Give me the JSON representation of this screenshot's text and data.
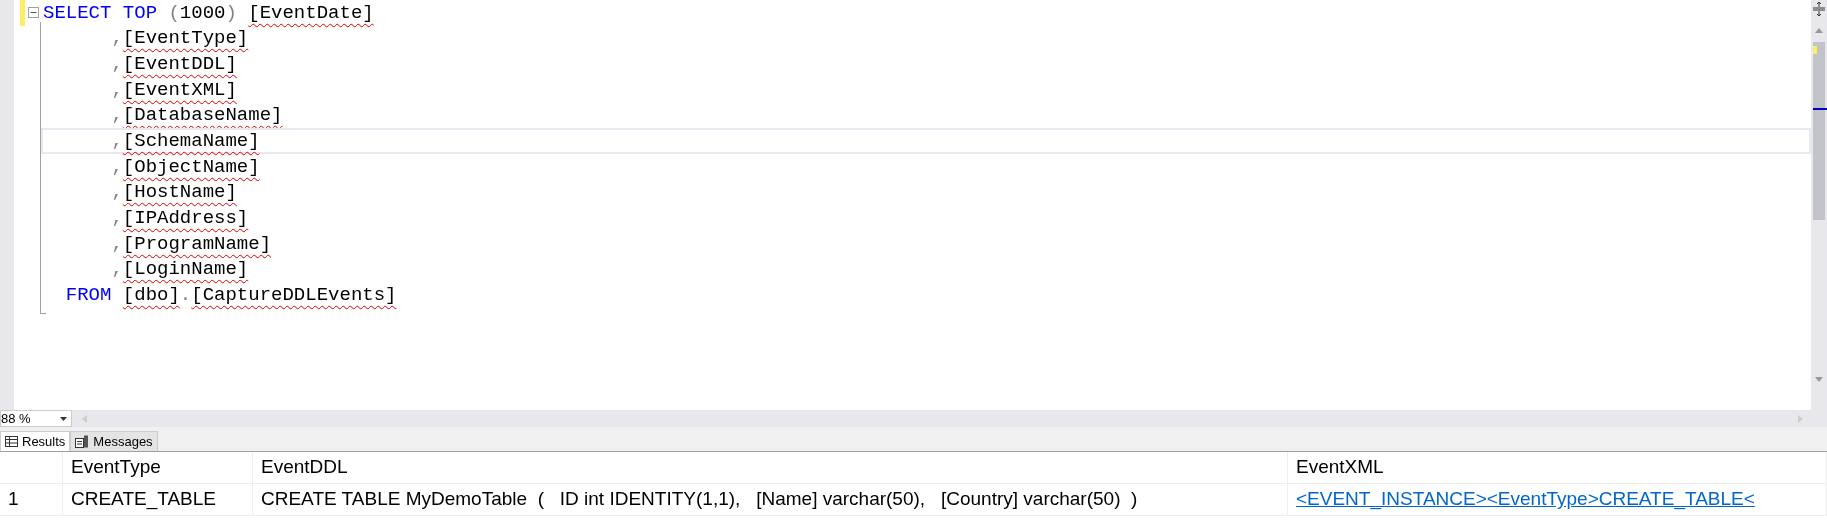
{
  "editor": {
    "lines": [
      {
        "changed": true,
        "current": false,
        "fold": true,
        "tokens": [
          {
            "text": "SELECT ",
            "kind": "keyword"
          },
          {
            "text": "TOP ",
            "kind": "keyword"
          },
          {
            "text": "(",
            "kind": "punct"
          },
          {
            "text": "1000",
            "kind": "number"
          },
          {
            "text": ") ",
            "kind": "punct"
          },
          {
            "text": "[EventDate]",
            "kind": "ident"
          }
        ]
      },
      {
        "changed": false,
        "current": false,
        "fold": false,
        "tokens": [
          {
            "text": "      ,",
            "kind": "punct"
          },
          {
            "text": "[EventType]",
            "kind": "ident"
          }
        ]
      },
      {
        "changed": false,
        "current": false,
        "fold": false,
        "tokens": [
          {
            "text": "      ,",
            "kind": "punct"
          },
          {
            "text": "[EventDDL]",
            "kind": "ident"
          }
        ]
      },
      {
        "changed": false,
        "current": false,
        "fold": false,
        "tokens": [
          {
            "text": "      ,",
            "kind": "punct"
          },
          {
            "text": "[EventXML]",
            "kind": "ident"
          }
        ]
      },
      {
        "changed": false,
        "current": false,
        "fold": false,
        "tokens": [
          {
            "text": "      ,",
            "kind": "punct"
          },
          {
            "text": "[DatabaseName]",
            "kind": "ident"
          }
        ]
      },
      {
        "changed": false,
        "current": true,
        "fold": false,
        "tokens": [
          {
            "text": "      ,",
            "kind": "punct"
          },
          {
            "text": "[SchemaName]",
            "kind": "ident"
          }
        ]
      },
      {
        "changed": false,
        "current": false,
        "fold": false,
        "tokens": [
          {
            "text": "      ,",
            "kind": "punct"
          },
          {
            "text": "[ObjectName]",
            "kind": "ident"
          }
        ]
      },
      {
        "changed": false,
        "current": false,
        "fold": false,
        "tokens": [
          {
            "text": "      ,",
            "kind": "punct"
          },
          {
            "text": "[HostName]",
            "kind": "ident"
          }
        ]
      },
      {
        "changed": false,
        "current": false,
        "fold": false,
        "tokens": [
          {
            "text": "      ,",
            "kind": "punct"
          },
          {
            "text": "[IPAddress]",
            "kind": "ident"
          }
        ]
      },
      {
        "changed": false,
        "current": false,
        "fold": false,
        "tokens": [
          {
            "text": "      ,",
            "kind": "punct"
          },
          {
            "text": "[ProgramName]",
            "kind": "ident"
          }
        ]
      },
      {
        "changed": false,
        "current": false,
        "fold": false,
        "tokens": [
          {
            "text": "      ,",
            "kind": "punct"
          },
          {
            "text": "[LoginName]",
            "kind": "ident"
          }
        ]
      },
      {
        "changed": false,
        "current": false,
        "fold": false,
        "tokens": [
          {
            "text": "  FROM ",
            "kind": "keyword"
          },
          {
            "text": "[dbo]",
            "kind": "ident"
          },
          {
            "text": ".",
            "kind": "punct"
          },
          {
            "text": "[CaptureDDLEvents]",
            "kind": "ident"
          }
        ]
      }
    ]
  },
  "zoom": {
    "value": "88 %"
  },
  "result_tabs": [
    {
      "label": "Results",
      "selected": true,
      "kind": "grid"
    },
    {
      "label": "Messages",
      "selected": false,
      "kind": "messages"
    }
  ],
  "results": {
    "columns": [
      "EventType",
      "EventDDL",
      "EventXML"
    ],
    "rows": [
      {
        "number": "1",
        "cells": [
          {
            "text": "CREATE_TABLE",
            "kind": "text"
          },
          {
            "text": "CREATE TABLE MyDemoTable  (   ID int IDENTITY(1,1),   [Name] varchar(50),   [Country] varchar(50)  )",
            "kind": "text"
          },
          {
            "text": "<EVENT_INSTANCE><EventType>CREATE_TABLE<",
            "kind": "link"
          }
        ]
      }
    ]
  }
}
